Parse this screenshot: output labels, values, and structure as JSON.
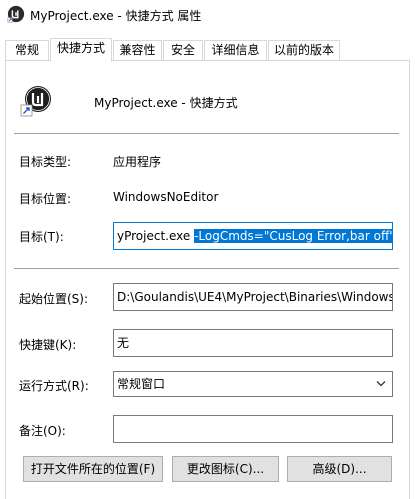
{
  "window": {
    "title": "MyProject.exe - 快捷方式 属性",
    "icon": "unreal-engine-icon"
  },
  "tabs": [
    {
      "label": "常规",
      "active": false
    },
    {
      "label": "快捷方式",
      "active": true
    },
    {
      "label": "兼容性",
      "active": false
    },
    {
      "label": "安全",
      "active": false
    },
    {
      "label": "详细信息",
      "active": false
    },
    {
      "label": "以前的版本",
      "active": false
    }
  ],
  "shortcut": {
    "heading": "MyProject.exe - 快捷方式",
    "target_type_label": "目标类型:",
    "target_type_value": "应用程序",
    "target_location_label": "目标位置:",
    "target_location_value": "WindowsNoEditor",
    "target_label": "目标(T):",
    "target_value_plain": "yProject.exe ",
    "target_value_selected": "-LogCmds=\"CusLog Error,bar off\"",
    "start_in_label": "起始位置(S):",
    "start_in_value": "D:\\Goulandis\\UE4\\MyProject\\Binaries\\Windows",
    "hotkey_label": "快捷键(K):",
    "hotkey_value": "无",
    "run_label": "运行方式(R):",
    "run_value": "常规窗口",
    "comment_label": "备注(O):",
    "comment_value": ""
  },
  "buttons": {
    "open_location": "打开文件所在的位置(F)",
    "change_icon": "更改图标(C)...",
    "advanced": "高级(D)..."
  },
  "colors": {
    "selection": "#0078d7",
    "focus_border": "#0078d7"
  }
}
